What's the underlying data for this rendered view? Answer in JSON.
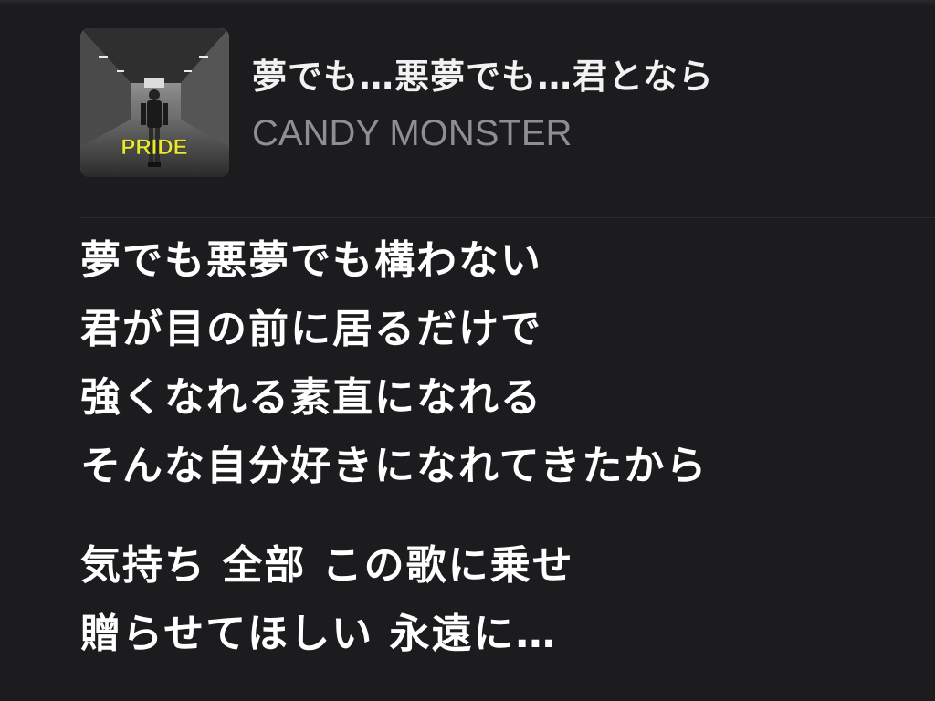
{
  "now_playing": {
    "title": "夢でも…悪夢でも…君となら",
    "artist": "CANDY MONSTER",
    "artwork": {
      "text": "PRIDE",
      "accent_color": "#e8e83a"
    }
  },
  "lyrics": {
    "stanzas": [
      {
        "lines": [
          "夢でも悪夢でも構わない",
          "君が目の前に居るだけで",
          "強くなれる素直になれる",
          "そんな自分好きになれてきたから"
        ]
      },
      {
        "lines": [
          "気持ち 全部 この歌に乗せ",
          "贈らせてほしい 永遠に…"
        ]
      }
    ]
  },
  "colors": {
    "background": "#1c1c1e",
    "title": "#f2f2f2",
    "artist": "#8e8e93",
    "lyrics": "#ffffff"
  }
}
